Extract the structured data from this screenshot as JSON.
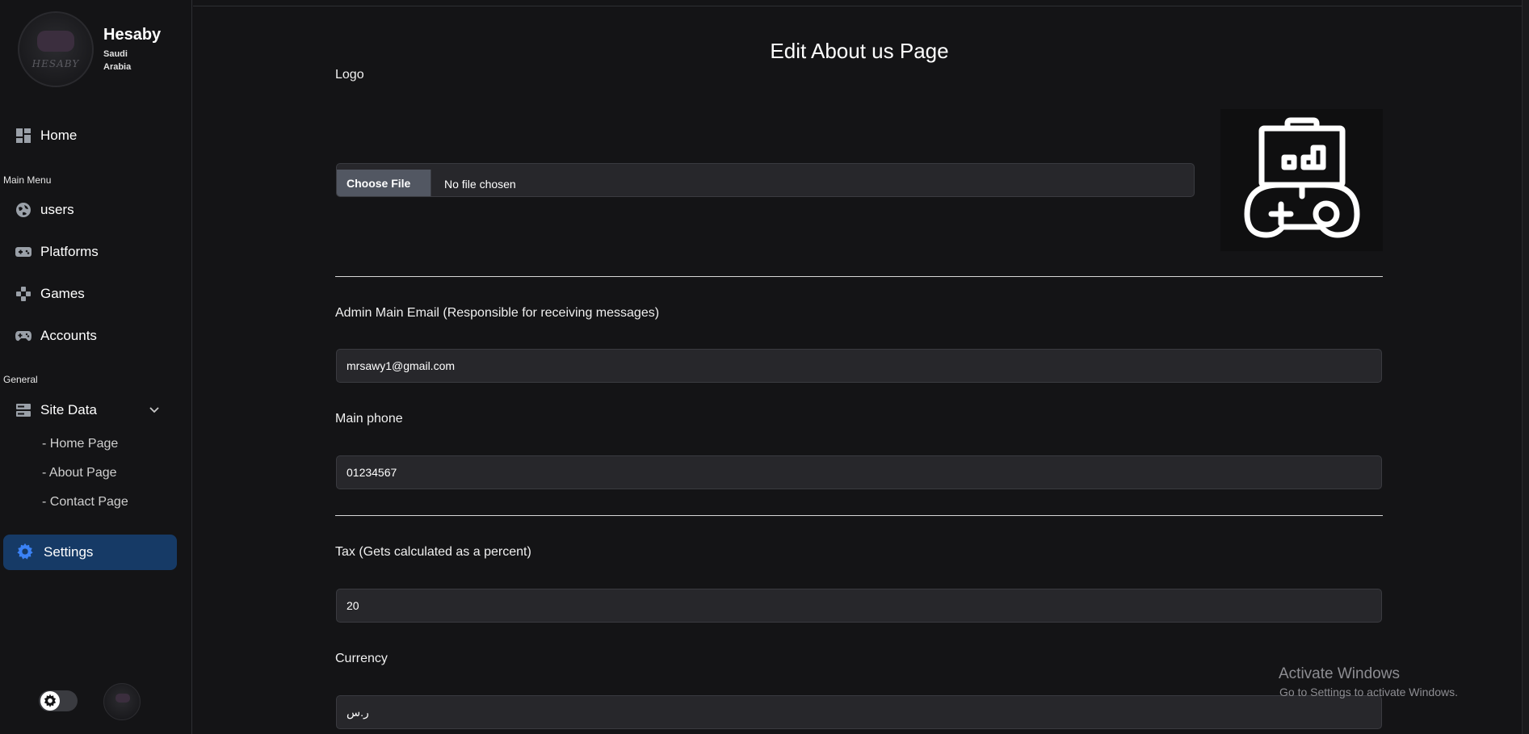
{
  "brand": {
    "name": "Hesaby",
    "subtitle": "Saudi Arabia",
    "logo_word": "HESABY"
  },
  "sidebar": {
    "home": {
      "label": "Home",
      "icon": "dashboard-icon"
    },
    "main_menu_label": "Main Menu",
    "main_items": [
      {
        "label": "users",
        "icon": "globe-icon"
      },
      {
        "label": "Platforms",
        "icon": "console-icon"
      },
      {
        "label": "Games",
        "icon": "dpad-icon"
      },
      {
        "label": "Accounts",
        "icon": "gamepad-icon"
      }
    ],
    "general_label": "General",
    "site_data": {
      "label": "Site Data",
      "icon": "server-icon",
      "expanded": true
    },
    "site_data_items": [
      {
        "label": "- Home Page"
      },
      {
        "label": "- About Page"
      },
      {
        "label": "- Contact Page"
      }
    ],
    "settings": {
      "label": "Settings",
      "icon": "gear-icon",
      "active": true
    }
  },
  "main": {
    "title": "Edit About us Page",
    "logo_label": "Logo",
    "file_input": {
      "button": "Choose File",
      "status": "No file chosen"
    },
    "email": {
      "label": "Admin Main Email (Responsible for receiving messages)",
      "value": "mrsawy1@gmail.com"
    },
    "phone": {
      "label": "Main phone",
      "value": "01234567"
    },
    "tax": {
      "label": "Tax (Gets calculated as a percent)",
      "value": "20"
    },
    "currency": {
      "label": "Currency",
      "value": "ر.س"
    }
  },
  "watermark": {
    "title": "Activate Windows",
    "subtitle": "Go to Settings to activate Windows."
  },
  "colors": {
    "background": "#141416",
    "accent": "#163a66",
    "field": "#27272b",
    "settings_icon": "#3b82f6"
  }
}
